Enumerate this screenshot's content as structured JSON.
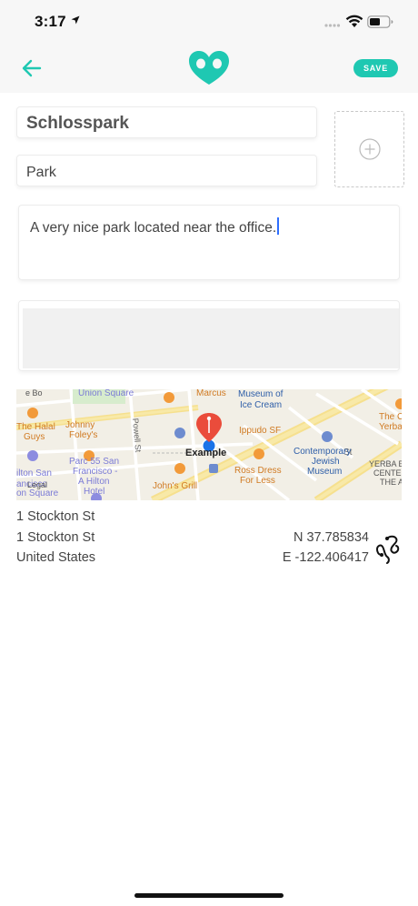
{
  "status_bar": {
    "time": "3:17"
  },
  "nav": {
    "save_label": "SAVE",
    "accent_color": "#1fc8b2"
  },
  "form": {
    "name": "Schlosspark",
    "type": "Park",
    "description": "A very nice park located near the office."
  },
  "map": {
    "labels": {
      "union_square": "Union Square",
      "marcus": "Marcus",
      "museum": "Museum of",
      "ice_cream": "Ice Cream",
      "halal1": "The Halal",
      "halal2": "Guys",
      "johnny1": "Johnny",
      "johnny2": "Foley's",
      "powell": "Powell St",
      "ippudo": "Ippudo SF",
      "example": "Example",
      "contemporary1": "Contemporary",
      "contemporary2": "Jewish",
      "contemporary3": "Museum",
      "parc1": "Parc 55 San",
      "parc2": "Francisco -",
      "parc3": "A Hilton",
      "parc4": "Hotel",
      "hilton1": "ilton San",
      "hilton2": "ancisco",
      "hilton3": "on Square",
      "legal": "Legal",
      "ross1": "Ross Dress",
      "ross2": "For Less",
      "johns": "John's Grill",
      "yerba1": "YERBA B",
      "yerba2": "CENTE",
      "yerba3": "THE A",
      "the_c1": "The C",
      "the_c2": "Yerba",
      "st": "St",
      "bo": "e Bo"
    }
  },
  "address": {
    "line1": "1 Stockton St",
    "line2": "1 Stockton St",
    "line3": "United States",
    "lat": "N 37.785834",
    "lng": "E -122.406417"
  }
}
